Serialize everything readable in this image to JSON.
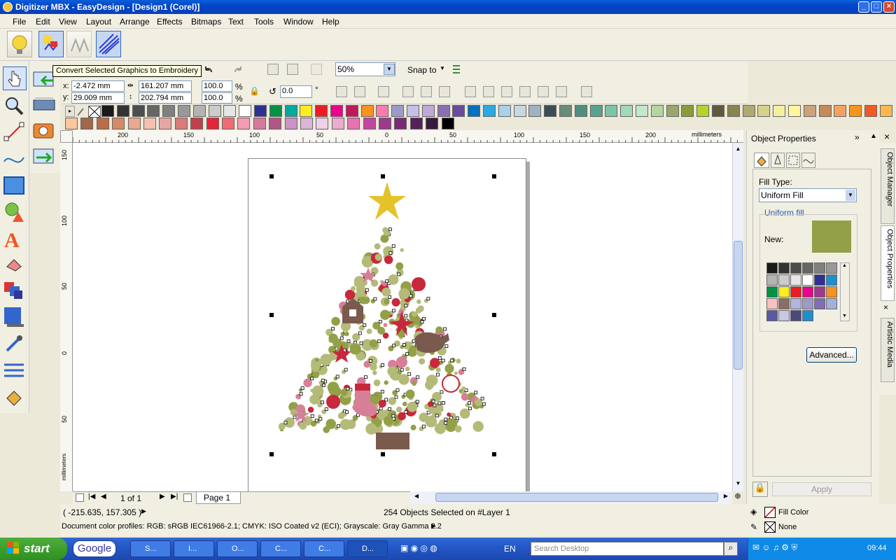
{
  "window": {
    "title": "Digitizer MBX - EasyDesign - [Design1 (Corel)]"
  },
  "menu": [
    "File",
    "Edit",
    "View",
    "Layout",
    "Arrange",
    "Effects",
    "Bitmaps",
    "Text",
    "Tools",
    "Window",
    "Help"
  ],
  "tooltip": "Convert Selected Graphics to Embroidery",
  "toolbar": {
    "zoom": "50%",
    "snap_to": "Snap to"
  },
  "properties": {
    "x": "-2.472 mm",
    "y": "29.009 mm",
    "w": "161.207 mm",
    "h": "202.794 mm",
    "sx": "100.0",
    "sy": "100.0",
    "pct": "%",
    "angle": "0.0",
    "deg": "°",
    "x_label": "x:",
    "y_label": "y:"
  },
  "rulers": {
    "h_ticks": [
      "200",
      "150",
      "100",
      "50",
      "0",
      "50",
      "100",
      "150",
      "200"
    ],
    "v_ticks": [
      "150",
      "100",
      "50",
      "0",
      "50"
    ],
    "unit": "millimeters"
  },
  "pagenav": {
    "counter": "1 of 1",
    "page_tab": "Page 1"
  },
  "panel": {
    "title": "Object Properties",
    "fill_type_label": "Fill Type:",
    "fill_type": "Uniform Fill",
    "group_label": "Uniform fill",
    "new_label": "New:",
    "new_color": "#93a048",
    "advanced": "Advanced...",
    "apply": "Apply"
  },
  "dockers": [
    "Object Manager",
    "Object Properties",
    "Artistic Media"
  ],
  "status": {
    "coords": "( -215.635, 157.305 )",
    "selection": "254 Objects Selected on #Layer 1",
    "color_profiles": "Document color profiles: RGB: sRGB IEC61966-2.1; CMYK: ISO Coated v2 (ECI); Grayscale: Gray Gamma 2.2",
    "fill_color": "Fill Color",
    "outline": "None"
  },
  "taskbar": {
    "start": "start",
    "google": "Google",
    "tasks": [
      "S...",
      "I...",
      "O...",
      "C...",
      "C...",
      "D..."
    ],
    "lang": "EN",
    "search_placeholder": "Search Desktop",
    "clock": "09:44"
  },
  "colors": {
    "tree_green": "#93a048",
    "star_yellow": "#e3c22a",
    "trunk_brown": "#7a5a4c",
    "pink": "#d77f98",
    "red": "#c8283c"
  }
}
